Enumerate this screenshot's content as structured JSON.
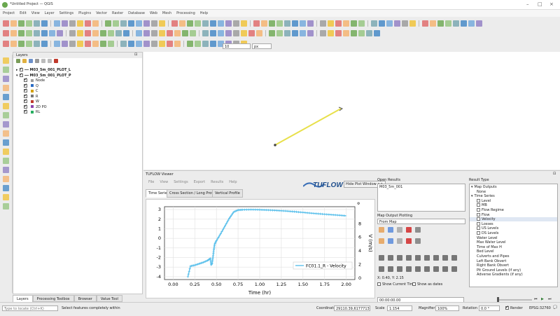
{
  "window": {
    "title": "*Untitled Project — QGIS"
  },
  "menu": [
    "Project",
    "Edit",
    "View",
    "Layer",
    "Settings",
    "Plugins",
    "Vector",
    "Raster",
    "Database",
    "Web",
    "Mesh",
    "Processing",
    "Help"
  ],
  "toolbar2": {
    "size_value": "10",
    "unit": "px"
  },
  "layers_panel": {
    "title": "Layers",
    "items": [
      {
        "label": "M03_5m_001_PLOT_L",
        "bold": true,
        "level": 0
      },
      {
        "label": "M03_5m_001_PLOT_P",
        "bold": true,
        "level": 0
      },
      {
        "label": "Node",
        "level": 1,
        "color": "#9b9b9b"
      },
      {
        "label": "Q",
        "level": 1,
        "color": "#2b6cc4"
      },
      {
        "label": "C",
        "level": 1,
        "color": "#d4a000"
      },
      {
        "label": "R",
        "level": 1,
        "color": "#777777"
      },
      {
        "label": "W",
        "level": 1,
        "color": "#c0392b"
      },
      {
        "label": "2D PO",
        "level": 1,
        "color": "#8e44ad"
      },
      {
        "label": "RL",
        "level": 1,
        "color": "#27ae60"
      }
    ]
  },
  "dock_tabs": [
    "Layers",
    "Processing Toolbox",
    "Browser",
    "Value Tool"
  ],
  "tuflow": {
    "title": "TUFLOW Viewer",
    "menu": [
      "File",
      "View",
      "Settings",
      "Export",
      "Results",
      "Help"
    ],
    "logo": "TUFLOW",
    "hide_plot_button": "Hide Plot Window >>",
    "tabs": [
      "Time Series",
      "Cross Section / Long Profile",
      "Vertical Profile"
    ],
    "open_results_label": "Open Results",
    "open_results_item": "M03_5m_001",
    "map_output_label": "Map Output Plotting",
    "from_map": "From Map",
    "coords": "X: 0.40, Y: 2.15",
    "show_current_time": "Show Current Time",
    "show_as_dates": "Show as dates",
    "time_value": "00:00:00.00",
    "result_type_label": "Result Type",
    "result_tree": [
      {
        "label": "Map Outputs",
        "level": 0,
        "expander": "▾"
      },
      {
        "label": "None",
        "level": 1
      },
      {
        "label": "Time Series",
        "level": 0,
        "expander": "▾"
      },
      {
        "label": "Level",
        "level": 1,
        "box": true
      },
      {
        "label": "MB",
        "level": 1,
        "box": true
      },
      {
        "label": "Flow Regime",
        "level": 1,
        "box": true
      },
      {
        "label": "Flow",
        "level": 1,
        "box": true
      },
      {
        "label": "Velocity",
        "level": 1,
        "box": true,
        "selected": true
      },
      {
        "label": "Losses",
        "level": 1,
        "box": true
      },
      {
        "label": "US Levels",
        "level": 1,
        "box": true
      },
      {
        "label": "DS Levels",
        "level": 1,
        "box": true
      },
      {
        "label": "Water Level",
        "level": 1
      },
      {
        "label": "Max Water Level",
        "level": 1
      },
      {
        "label": "Time of Max H",
        "level": 1
      },
      {
        "label": "Bed Level",
        "level": 1
      },
      {
        "label": "Culverts and Pipes",
        "level": 1
      },
      {
        "label": "Left Bank Obvert",
        "level": 1
      },
      {
        "label": "Right Bank Obvert",
        "level": 1
      },
      {
        "label": "Pit Ground Levels (if any)",
        "level": 1
      },
      {
        "label": "Adverse Gradients (if any)",
        "level": 1
      }
    ]
  },
  "chart_data": {
    "type": "line",
    "xlabel": "Time (hr)",
    "ylabel_left": "",
    "ylabel_right": "V (m/s)",
    "xlim": [
      -0.1,
      2.1
    ],
    "ylim_left": [
      -4.3,
      3.3
    ],
    "ylim_right": [
      -0.2,
      10.5
    ],
    "xticks": [
      "0.00",
      "0.25",
      "0.50",
      "0.75",
      "1.00",
      "1.25",
      "1.50",
      "1.75",
      "2.00"
    ],
    "yticks_left": [
      "-4",
      "-3",
      "-2",
      "-1",
      "0",
      "1",
      "2",
      "3"
    ],
    "yticks_right": [
      "0",
      "2",
      "4",
      "6",
      "8"
    ],
    "grid": true,
    "legend_position": "bottom-right",
    "color": "#5bc0eb",
    "series": [
      {
        "name": "FC01.1_R - Velocity",
        "x": [
          0.17,
          0.2,
          0.25,
          0.3,
          0.35,
          0.4,
          0.43,
          0.44,
          0.45,
          0.46,
          0.47,
          0.48,
          0.5,
          0.55,
          0.6,
          0.65,
          0.7,
          0.75,
          0.8,
          0.9,
          1.0,
          1.1,
          1.2,
          1.3,
          1.4,
          1.5,
          1.6,
          1.7,
          1.8,
          1.9,
          2.0
        ],
        "y": [
          -4.0,
          -2.9,
          -2.8,
          -2.65,
          -2.5,
          -2.3,
          -2.1,
          -2.75,
          -2.6,
          -1.95,
          -1.2,
          -0.6,
          -0.25,
          0.5,
          1.3,
          2.1,
          2.75,
          2.95,
          2.98,
          3.0,
          2.98,
          2.95,
          2.9,
          2.85,
          2.78,
          2.7,
          2.62,
          2.55,
          2.48,
          2.42,
          2.35
        ]
      }
    ]
  },
  "status": {
    "locate_placeholder": "Type to locate (Ctrl+K)",
    "message": "Select features completely within",
    "coordinate_label": "Coordinate",
    "coordinate_value": "29110.39,6177713.51",
    "scale_label": "Scale",
    "scale_value": "1:154",
    "magnifier_label": "Magnifier",
    "magnifier_value": "100%",
    "rotation_label": "Rotation",
    "rotation_value": "0.0 °",
    "render_label": "Render",
    "crs": "EPSG:32760"
  }
}
